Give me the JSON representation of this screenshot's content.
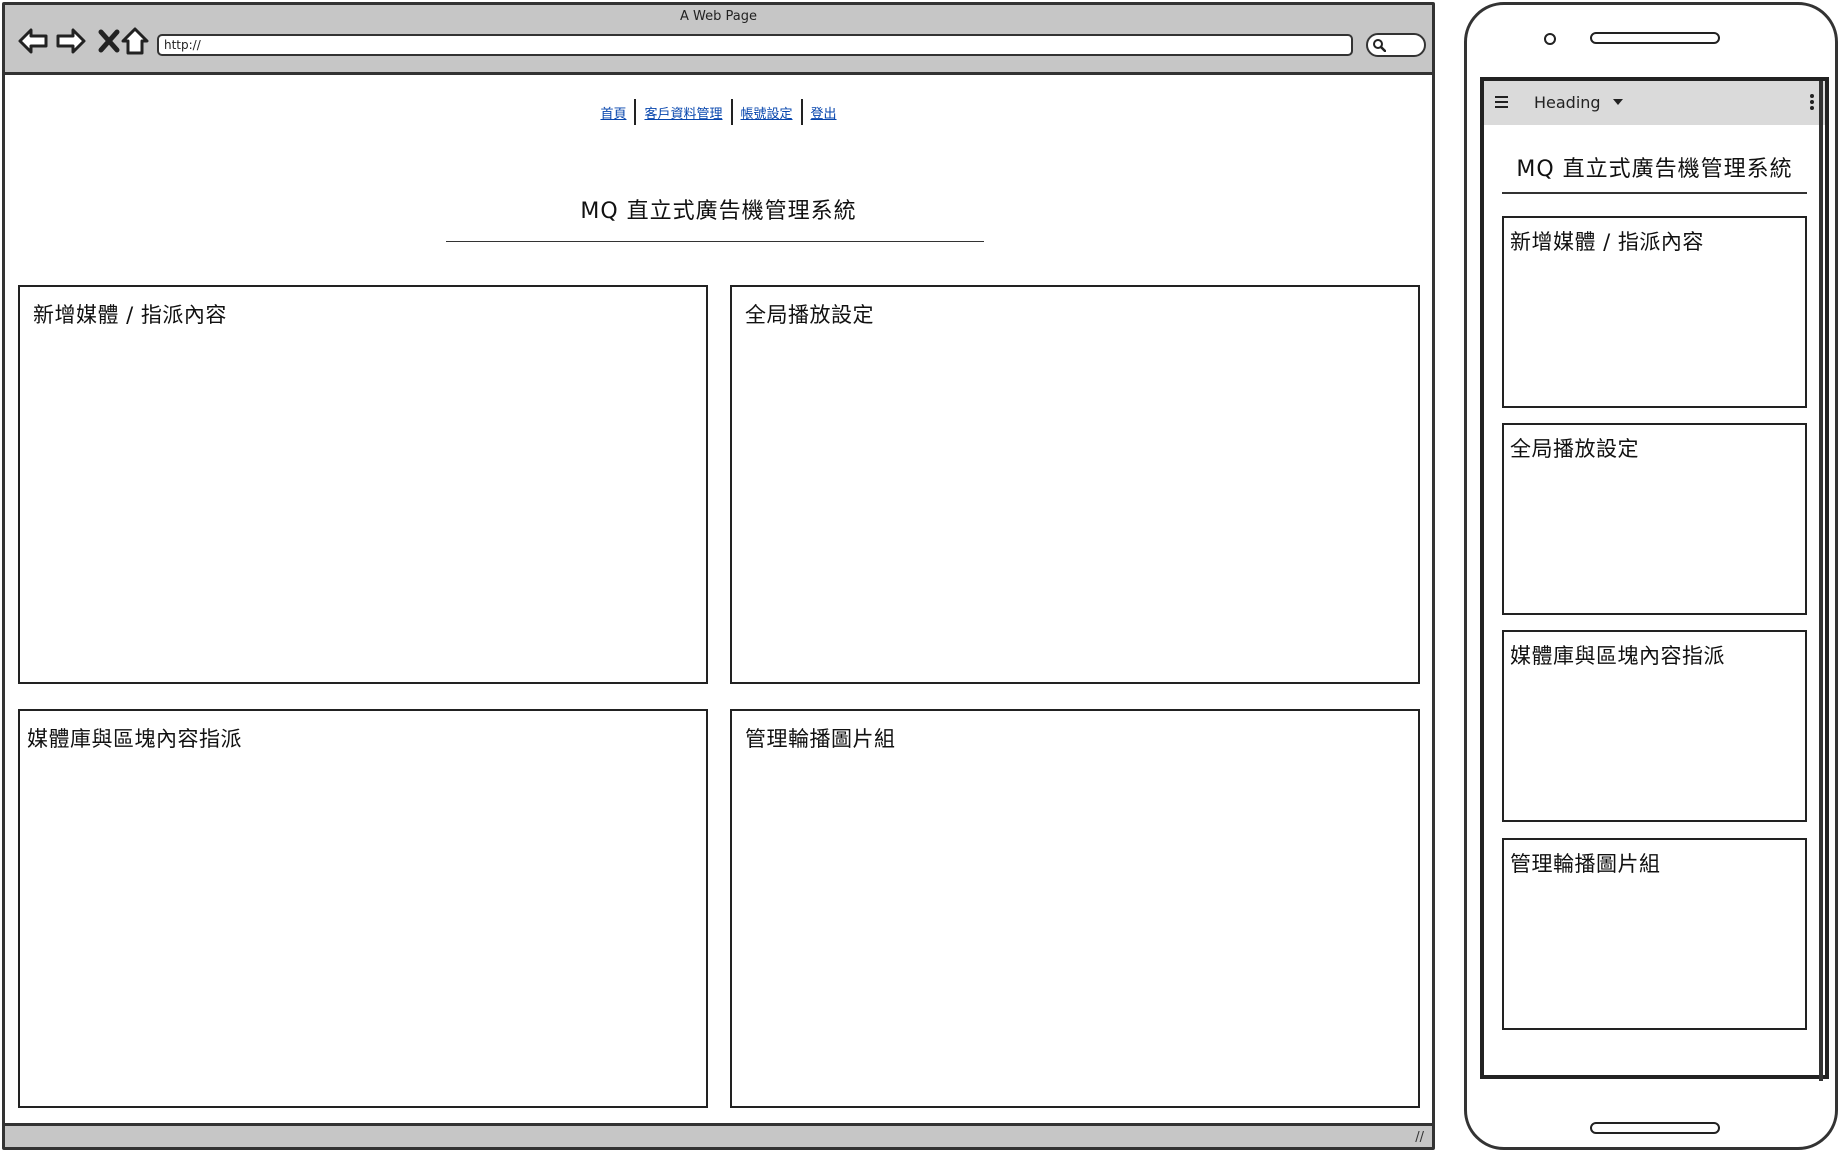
{
  "browser": {
    "window_title": "A Web Page",
    "url": "http://",
    "nav_links": [
      "首頁",
      "客戶資料管理",
      "帳號設定",
      "登出"
    ],
    "page_title": "MQ 直立式廣告機管理系統",
    "panels": [
      "新增媒體 / 指派內容",
      "全局播放設定",
      "媒體庫與區塊內容指派",
      "管理輪播圖片組"
    ],
    "resize_grip": "//"
  },
  "phone": {
    "app_bar_title": "Heading",
    "page_title": "MQ 直立式廣告機管理系統",
    "cards": [
      "新增媒體 / 指派內容",
      "全局播放設定",
      "媒體庫與區塊內容指派",
      "管理輪播圖片組"
    ]
  },
  "icons": {
    "back": "arrow-left-icon",
    "forward": "arrow-right-icon",
    "stop": "close-icon",
    "home": "home-icon",
    "search": "search-icon",
    "menu": "hamburger-icon",
    "dropdown": "caret-down-icon",
    "overflow": "more-vert-icon"
  },
  "colors": {
    "chrome_bar": "#c6c6c6",
    "app_bar": "#dadada",
    "link": "#0645ad",
    "stroke": "#222222"
  }
}
